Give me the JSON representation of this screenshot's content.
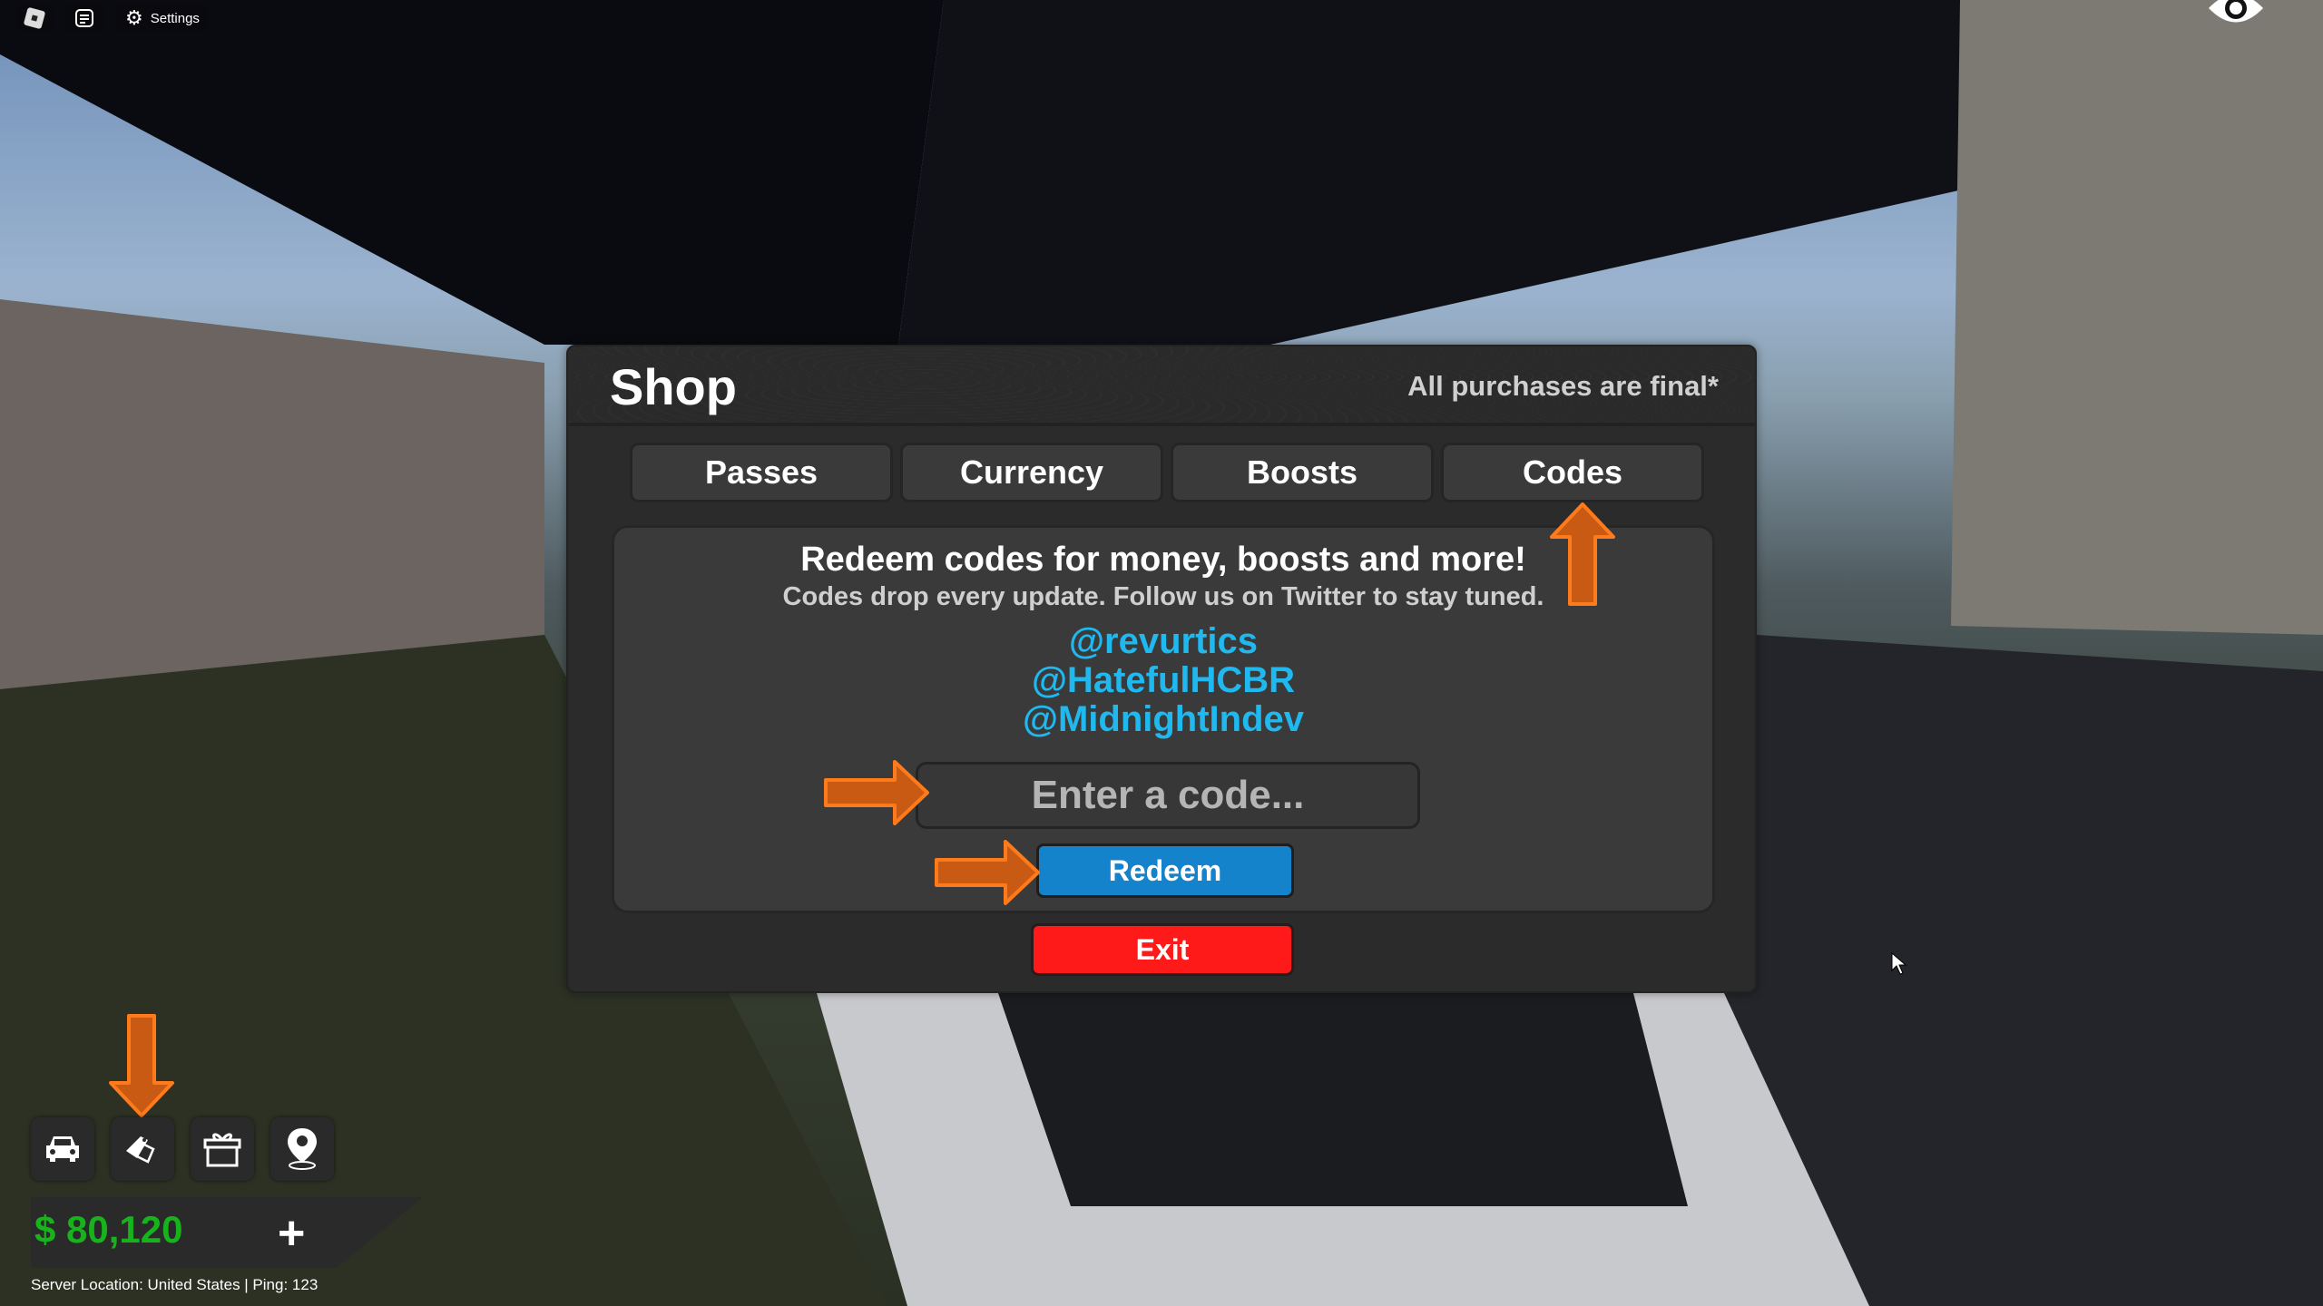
{
  "topbar": {
    "roblox_menu_icon": "roblox-logo-icon",
    "chat_icon": "chat-icon",
    "settings_label": "Settings"
  },
  "shop": {
    "title": "Shop",
    "note": "All purchases are final*",
    "tabs": [
      {
        "label": "Passes"
      },
      {
        "label": "Currency"
      },
      {
        "label": "Boosts"
      },
      {
        "label": "Codes",
        "active": true
      }
    ],
    "codes": {
      "headline": "Redeem codes for money, boosts and more!",
      "subline": "Codes drop every update. Follow us on Twitter to stay tuned.",
      "handles": [
        "@revurtics",
        "@HatefulHCBR",
        "@MidnightIndev"
      ],
      "input_placeholder": "Enter a code...",
      "redeem_label": "Redeem"
    },
    "exit_label": "Exit"
  },
  "hud": {
    "buttons": [
      {
        "icon": "car-icon"
      },
      {
        "icon": "price-tag-icon"
      },
      {
        "icon": "gift-icon"
      },
      {
        "icon": "map-pin-icon"
      }
    ],
    "money": "$ 80,120",
    "add_money_label": "+",
    "server_info": "Server Location:  United States | Ping: 123"
  },
  "colors": {
    "accent_blue": "#1582cc",
    "handle_blue": "#1fb8ef",
    "exit_red": "#ff1a1a",
    "money_green": "#17b31d",
    "arrow_orange": "#c85a14"
  }
}
